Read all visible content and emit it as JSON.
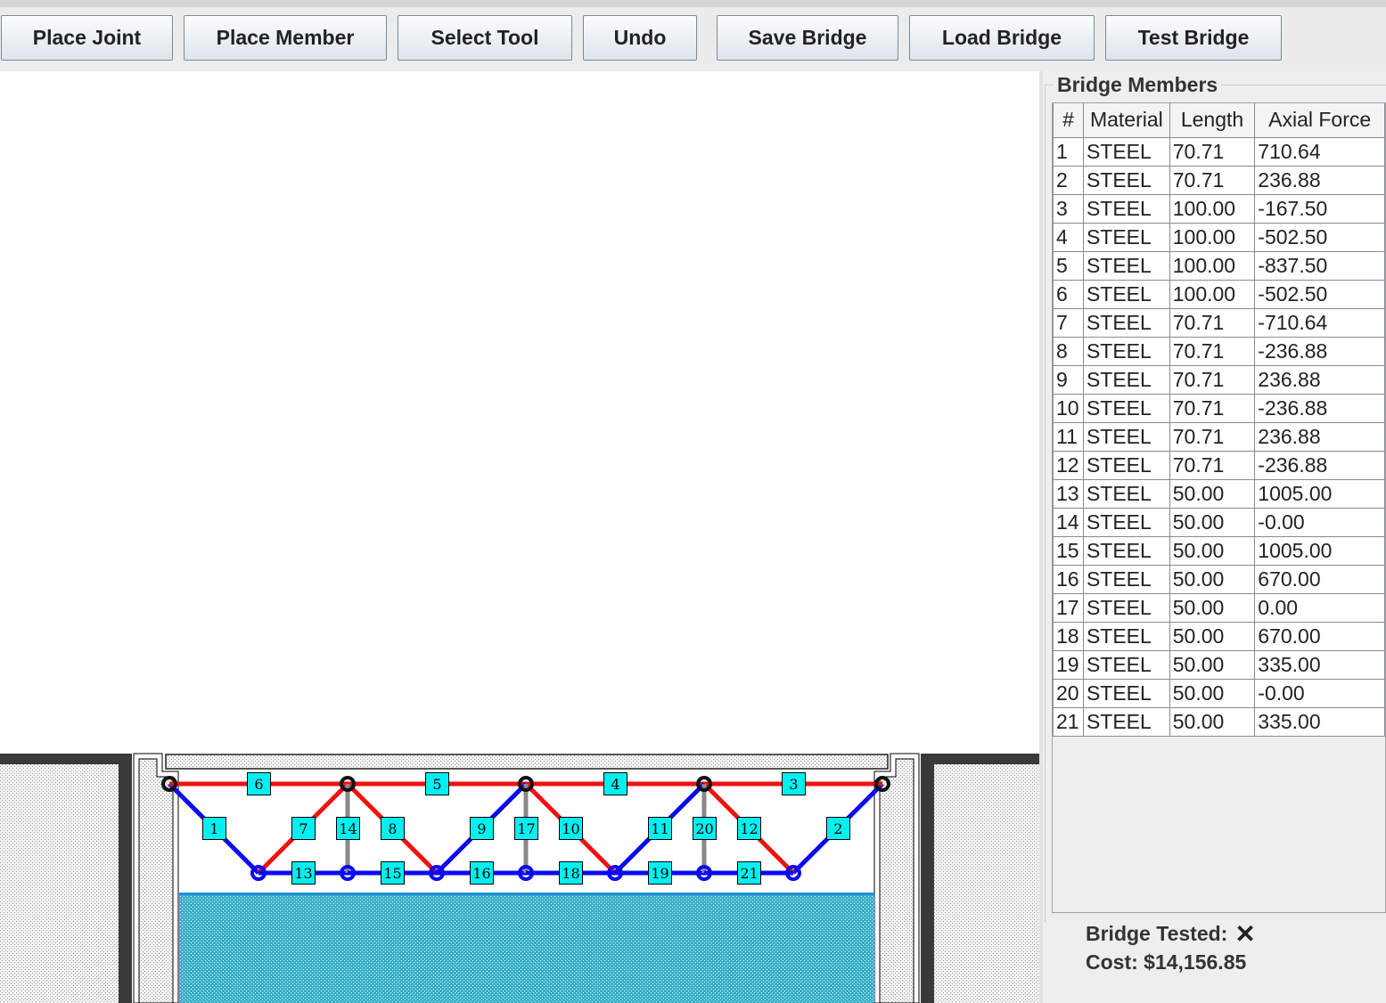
{
  "toolbar": {
    "place_joint": "Place Joint",
    "place_member": "Place Member",
    "select_tool": "Select Tool",
    "undo": "Undo",
    "save_bridge": "Save Bridge",
    "load_bridge": "Load Bridge",
    "test_bridge": "Test Bridge"
  },
  "panel": {
    "title": "Bridge Members",
    "columns": [
      "#",
      "Material",
      "Length",
      "Axial Force"
    ],
    "rows": [
      [
        "1",
        "STEEL",
        "70.71",
        "710.64"
      ],
      [
        "2",
        "STEEL",
        "70.71",
        "236.88"
      ],
      [
        "3",
        "STEEL",
        "100.00",
        "-167.50"
      ],
      [
        "4",
        "STEEL",
        "100.00",
        "-502.50"
      ],
      [
        "5",
        "STEEL",
        "100.00",
        "-837.50"
      ],
      [
        "6",
        "STEEL",
        "100.00",
        "-502.50"
      ],
      [
        "7",
        "STEEL",
        "70.71",
        "-710.64"
      ],
      [
        "8",
        "STEEL",
        "70.71",
        "-236.88"
      ],
      [
        "9",
        "STEEL",
        "70.71",
        "236.88"
      ],
      [
        "10",
        "STEEL",
        "70.71",
        "-236.88"
      ],
      [
        "11",
        "STEEL",
        "70.71",
        "236.88"
      ],
      [
        "12",
        "STEEL",
        "70.71",
        "-236.88"
      ],
      [
        "13",
        "STEEL",
        "50.00",
        "1005.00"
      ],
      [
        "14",
        "STEEL",
        "50.00",
        "-0.00"
      ],
      [
        "15",
        "STEEL",
        "50.00",
        "1005.00"
      ],
      [
        "16",
        "STEEL",
        "50.00",
        "670.00"
      ],
      [
        "17",
        "STEEL",
        "50.00",
        "0.00"
      ],
      [
        "18",
        "STEEL",
        "50.00",
        "670.00"
      ],
      [
        "19",
        "STEEL",
        "50.00",
        "335.00"
      ],
      [
        "20",
        "STEEL",
        "50.00",
        "-0.00"
      ],
      [
        "21",
        "STEEL",
        "50.00",
        "335.00"
      ]
    ]
  },
  "status": {
    "tested_label": "Bridge Tested:",
    "tested_icon": "x-icon",
    "tested_value": "✕",
    "cost_label": "Cost: $14,156.85"
  },
  "colors": {
    "tension": "#0a0af0",
    "compression": "#ee1111",
    "zero_force": "#888888",
    "label_fill": "#00f0f0",
    "water": "#3ab0c8"
  },
  "members": [
    {
      "id": "1",
      "from": "A",
      "to": "B",
      "state": "tension"
    },
    {
      "id": "2",
      "from": "H",
      "to": "M",
      "state": "tension"
    },
    {
      "id": "3",
      "from": "L",
      "to": "M",
      "state": "compression"
    },
    {
      "id": "4",
      "from": "K",
      "to": "L",
      "state": "compression"
    },
    {
      "id": "5",
      "from": "J",
      "to": "K",
      "state": "compression"
    },
    {
      "id": "6",
      "from": "A",
      "to": "J",
      "state": "compression"
    },
    {
      "id": "7",
      "from": "B",
      "to": "J",
      "state": "compression"
    },
    {
      "id": "8",
      "from": "J",
      "to": "D",
      "state": "compression"
    },
    {
      "id": "9",
      "from": "D",
      "to": "K",
      "state": "tension"
    },
    {
      "id": "10",
      "from": "K",
      "to": "F",
      "state": "compression"
    },
    {
      "id": "11",
      "from": "F",
      "to": "L",
      "state": "tension"
    },
    {
      "id": "12",
      "from": "L",
      "to": "H",
      "state": "compression"
    },
    {
      "id": "13",
      "from": "B",
      "to": "C",
      "state": "tension"
    },
    {
      "id": "14",
      "from": "J",
      "to": "C",
      "state": "zero"
    },
    {
      "id": "15",
      "from": "C",
      "to": "D",
      "state": "tension"
    },
    {
      "id": "16",
      "from": "D",
      "to": "E",
      "state": "tension"
    },
    {
      "id": "17",
      "from": "K",
      "to": "E",
      "state": "zero"
    },
    {
      "id": "18",
      "from": "E",
      "to": "F",
      "state": "tension"
    },
    {
      "id": "19",
      "from": "F",
      "to": "G",
      "state": "tension"
    },
    {
      "id": "20",
      "from": "L",
      "to": "G",
      "state": "zero"
    },
    {
      "id": "21",
      "from": "G",
      "to": "H",
      "state": "tension"
    }
  ]
}
